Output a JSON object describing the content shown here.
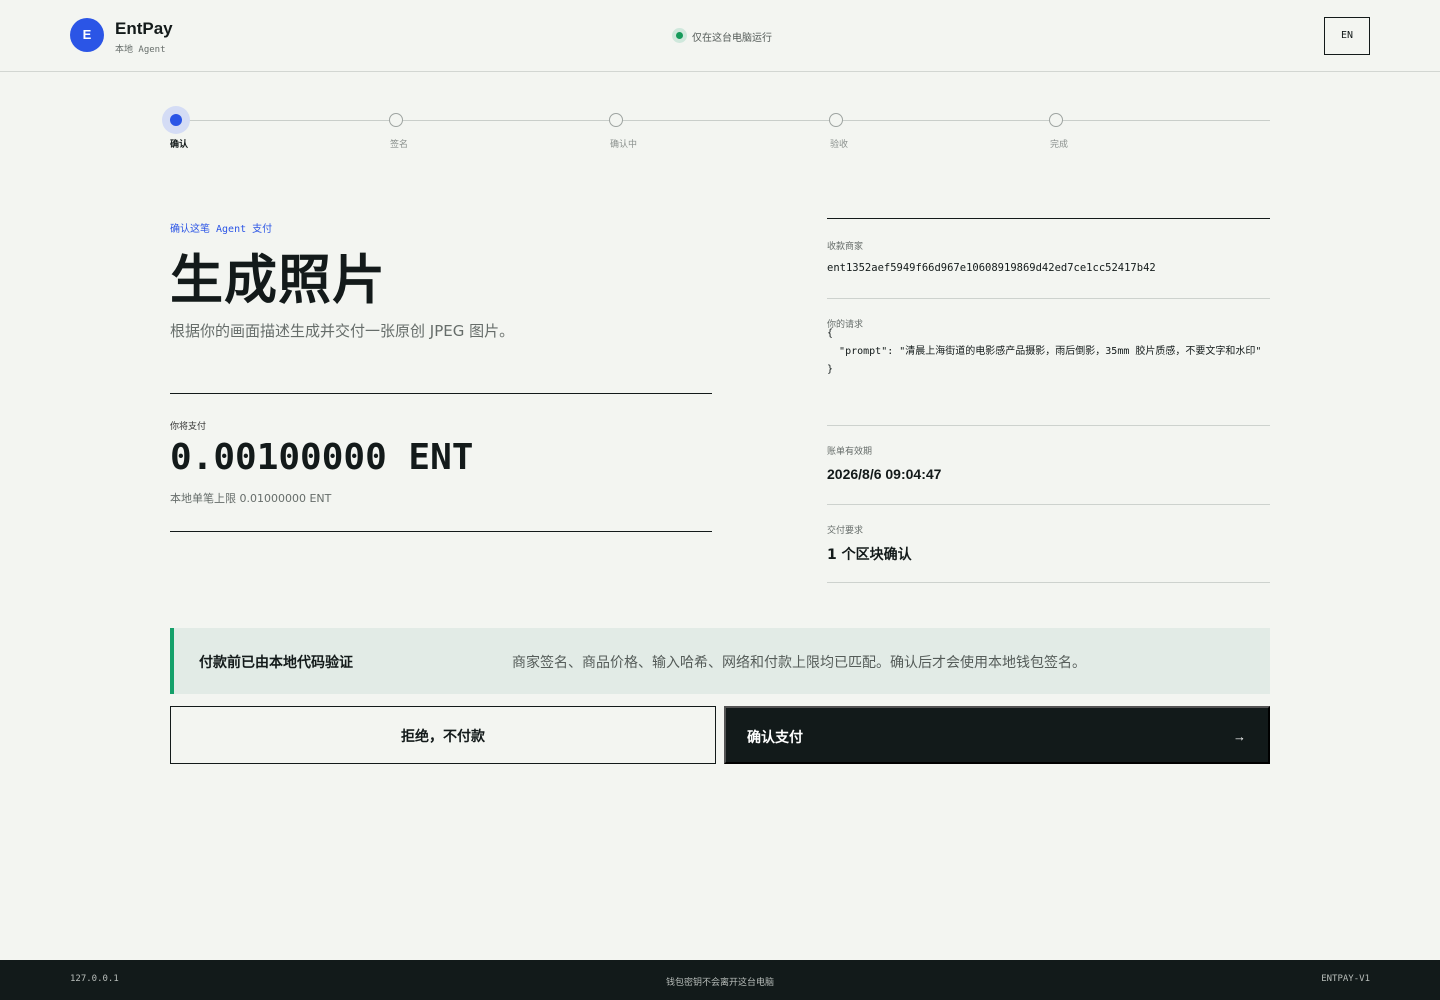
{
  "header": {
    "logo_letter": "E",
    "brand_name": "EntPay",
    "brand_sub": "本地 Agent",
    "run_status": "仅在这台电脑运行",
    "lang_button": "EN",
    "status_color": "#159a5a",
    "accent_color": "#2b55e6"
  },
  "stepper": {
    "current": 0,
    "steps": [
      "确认",
      "签名",
      "确认中",
      "验收",
      "完成"
    ]
  },
  "product": {
    "eyebrow": "确认这笔 Agent 支付",
    "title": "生成照片",
    "description": "根据你的画面描述生成并交付一张原创 JPEG 图片。"
  },
  "payment": {
    "label": "你将支付",
    "amount": "0.00100000 ENT",
    "limit": "本地单笔上限 0.01000000 ENT"
  },
  "details": {
    "merchant_label": "收款商家",
    "merchant_value": "ent1352aef5949f66d967e10608919869d42ed7ce1cc52417b42",
    "request_label": "你的请求",
    "request_value": "{\n  \"prompt\": \"清晨上海街道的电影感产品摄影，雨后倒影，35mm 胶片质感，不要文字和水印\"\n}",
    "expiry_label": "账单有效期",
    "expiry_value": "2026/8/6 09:04:47",
    "delivery_label": "交付要求",
    "delivery_value": "1 个区块确认"
  },
  "banner": {
    "title": "付款前已由本地代码验证",
    "text": "商家签名、商品价格、输入哈希、网络和付款上限均已匹配。确认后才会使用本地钱包签名。",
    "accent_color": "#15a06a"
  },
  "actions": {
    "reject_label": "拒绝，不付款",
    "confirm_label": "确认支付",
    "confirm_arrow": "→"
  },
  "footer": {
    "host": "127.0.0.1",
    "note": "钱包密钥不会离开这台电脑",
    "version": "ENTPAY-V1"
  }
}
